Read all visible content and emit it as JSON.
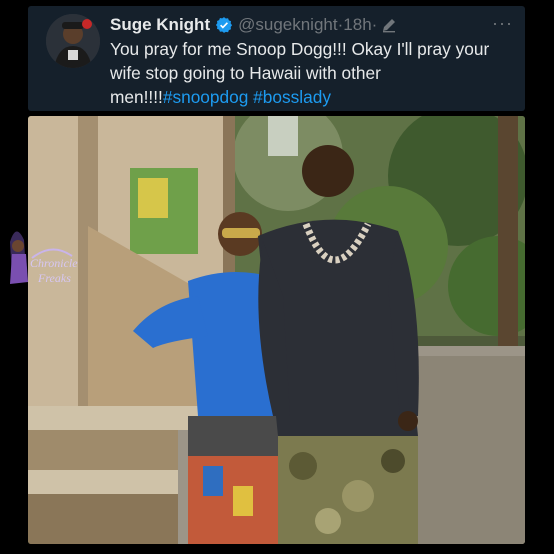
{
  "tweet": {
    "display_name": "Suge Knight",
    "handle": "@sugeknight",
    "separator1": "·",
    "time": "18h",
    "separator2": "·",
    "more": "···",
    "text_main": "You pray for me Snoop Dogg!!! Okay I'll pray your wife stop going to Hawaii with other men!!!!",
    "hashtag1": "#snoopdog",
    "hashtag2": "#bosslady"
  },
  "icons": {
    "verified": "verified-badge-icon",
    "edit": "edit-pencil-icon",
    "more": "more-options-icon"
  },
  "colors": {
    "background": "#15202b",
    "text": "#e7e9ea",
    "muted": "#71767b",
    "link": "#1d9bf0"
  },
  "watermark": {
    "line1": "Chronicle",
    "line2": "Freaks"
  }
}
